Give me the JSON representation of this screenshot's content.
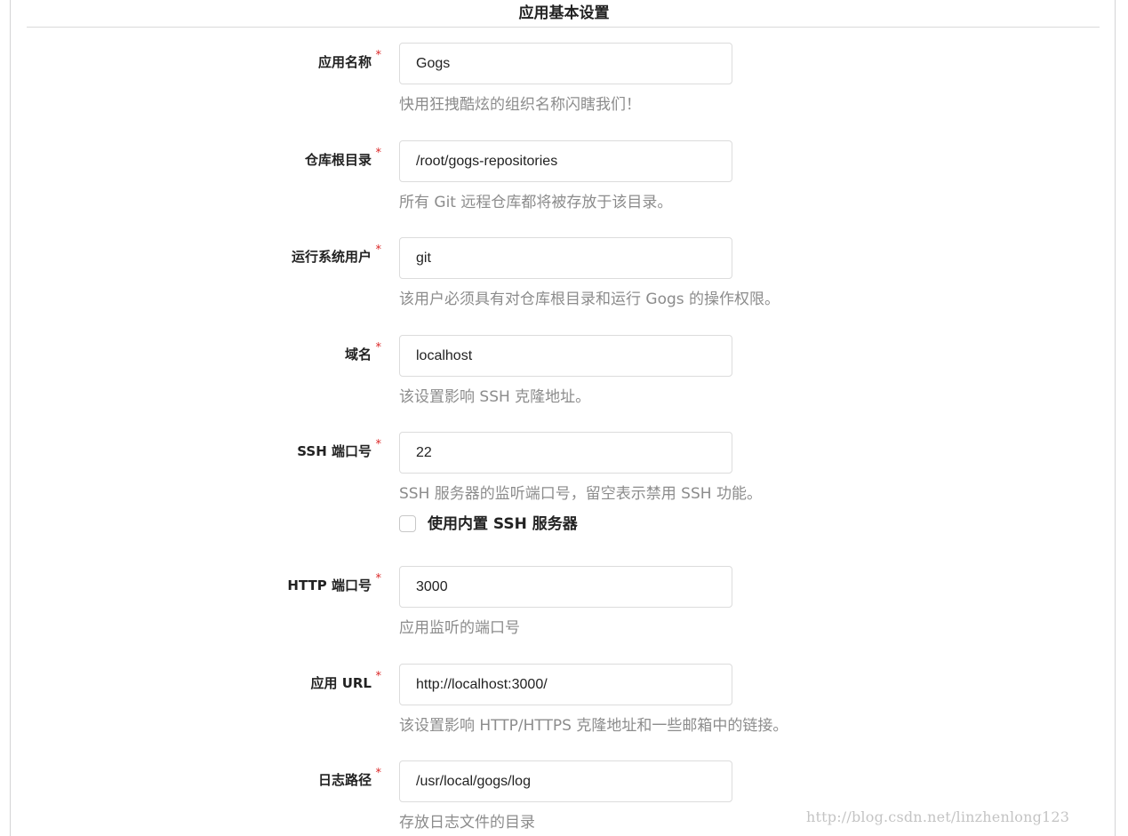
{
  "section": {
    "title": "应用基本设置"
  },
  "required_mark": "*",
  "fields": [
    {
      "label": "应用名称",
      "value": "Gogs",
      "help": "快用狂拽酷炫的组织名称闪瞎我们！"
    },
    {
      "label": "仓库根目录",
      "value": "/root/gogs-repositories",
      "help": "所有 Git 远程仓库都将被存放于该目录。"
    },
    {
      "label": "运行系统用户",
      "value": "git",
      "help": "该用户必须具有对仓库根目录和运行 Gogs 的操作权限。"
    },
    {
      "label": "域名",
      "value": "localhost",
      "help": "该设置影响 SSH 克隆地址。"
    },
    {
      "label": "SSH 端口号",
      "value": "22",
      "help": "SSH 服务器的监听端口号，留空表示禁用 SSH 功能。"
    },
    {
      "label": "HTTP 端口号",
      "value": "3000",
      "help": "应用监听的端口号"
    },
    {
      "label": "应用 URL",
      "value": "http://localhost:3000/",
      "help": "该设置影响 HTTP/HTTPS 克隆地址和一些邮箱中的链接。"
    },
    {
      "label": "日志路径",
      "value": "/usr/local/gogs/log",
      "help": "存放日志文件的目录"
    }
  ],
  "builtin_ssh": {
    "label": "使用内置 SSH 服务器",
    "checked": false
  },
  "watermark": {
    "text": "http://blog.csdn.net/linzhenlong123"
  },
  "colors": {
    "required": "#db2828",
    "help_text": "#8c8c8c",
    "border": "#dcdcdc"
  }
}
